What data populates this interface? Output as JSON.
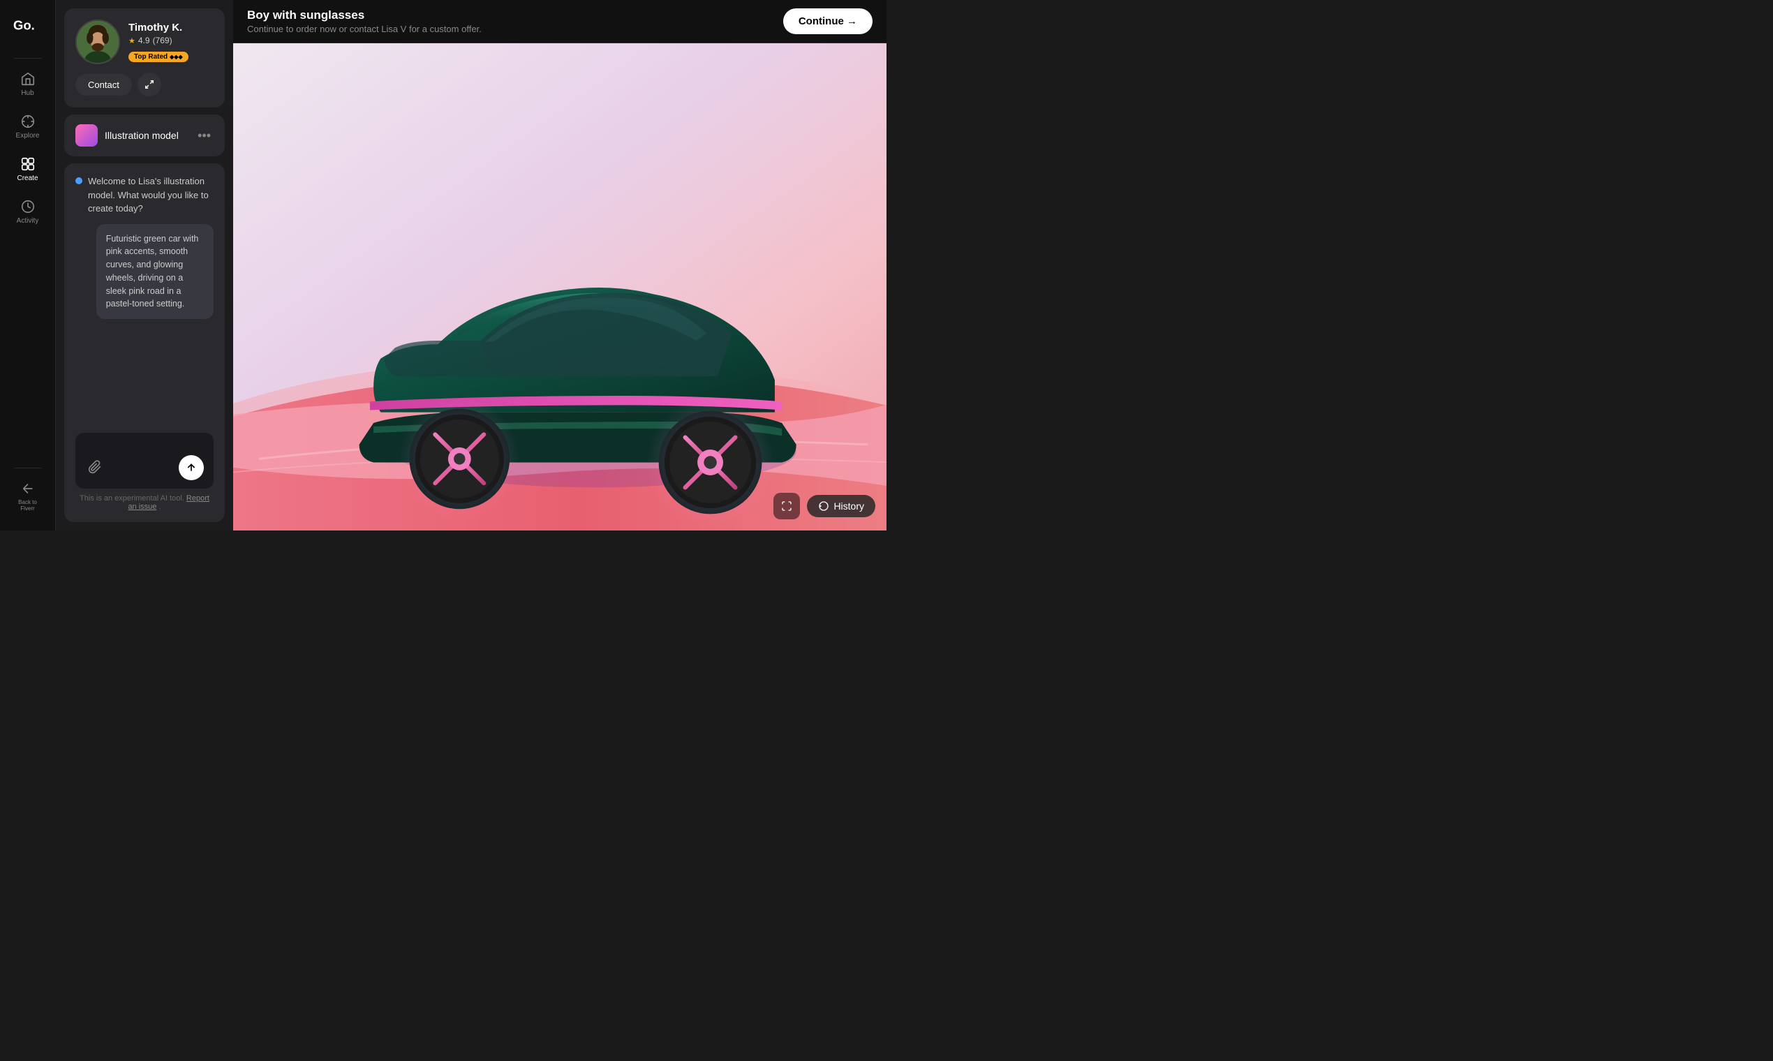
{
  "app": {
    "logo_text": "Go."
  },
  "sidebar": {
    "items": [
      {
        "id": "hub",
        "label": "Hub",
        "active": false
      },
      {
        "id": "explore",
        "label": "Explore",
        "active": false
      },
      {
        "id": "create",
        "label": "Create",
        "active": true
      },
      {
        "id": "activity",
        "label": "Activity",
        "active": false
      }
    ],
    "bottom_items": [
      {
        "id": "back-to-fiverr",
        "label": "Back to Fiverr",
        "active": false
      }
    ]
  },
  "profile": {
    "name": "Timothy K.",
    "rating": "4.9",
    "review_count": "769",
    "badge": "Top Rated",
    "badge_stars": "◆◆◆",
    "contact_label": "Contact",
    "expand_label": "⤢"
  },
  "model": {
    "name": "Illustration model",
    "more_label": "•••"
  },
  "chat": {
    "bot_message": "Welcome to Lisa's illustration model. What would you like to create today?",
    "user_message": "Futuristic green car with pink accents, smooth curves, and glowing wheels, driving on a sleek pink road in a pastel-toned setting.",
    "placeholder": "",
    "send_icon": "↑",
    "attach_icon": "📎",
    "disclaimer_text": "This is an experimental AI tool.",
    "disclaimer_link": "Report an issue",
    "disclaimer_period": "."
  },
  "image_panel": {
    "title": "Boy with sunglasses",
    "subtitle": "Continue to order now or contact Lisa V for a custom offer.",
    "continue_label": "Continue →",
    "history_label": "History",
    "expand_icon": "⛶"
  }
}
